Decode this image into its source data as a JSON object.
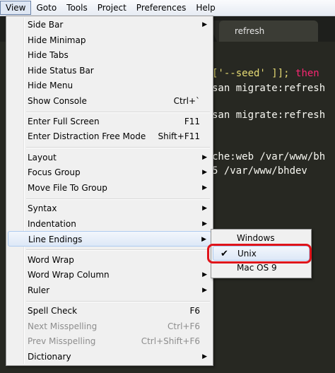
{
  "menubar": {
    "items": [
      "View",
      "Goto",
      "Tools",
      "Project",
      "Preferences",
      "Help"
    ],
    "active": "View"
  },
  "editor": {
    "tab_label": "refresh",
    "lines": {
      "l1a": "['--seed' ]]; ",
      "l1b": "then",
      "l2": "san migrate:refresh",
      "l3": "san migrate:refresh",
      "l4": "che:web /var/www/bh",
      "l5": "5 /var/www/bhdev"
    }
  },
  "view_menu": {
    "side_bar": "Side Bar",
    "hide_minimap": "Hide Minimap",
    "hide_tabs": "Hide Tabs",
    "hide_status_bar": "Hide Status Bar",
    "hide_menu": "Hide Menu",
    "show_console": "Show Console",
    "show_console_acc": "Ctrl+`",
    "enter_full_screen": "Enter Full Screen",
    "enter_full_screen_acc": "F11",
    "distraction_free": "Enter Distraction Free Mode",
    "distraction_free_acc": "Shift+F11",
    "layout": "Layout",
    "focus_group": "Focus Group",
    "move_file": "Move File To Group",
    "syntax": "Syntax",
    "indentation": "Indentation",
    "line_endings": "Line Endings",
    "word_wrap": "Word Wrap",
    "word_wrap_column": "Word Wrap Column",
    "ruler": "Ruler",
    "spell_check": "Spell Check",
    "spell_check_acc": "F6",
    "next_misspelling": "Next Misspelling",
    "next_misspelling_acc": "Ctrl+F6",
    "prev_misspelling": "Prev Misspelling",
    "prev_misspelling_acc": "Ctrl+Shift+F6",
    "dictionary": "Dictionary"
  },
  "line_endings_menu": {
    "windows": "Windows",
    "unix": "Unix",
    "mac": "Mac OS 9",
    "checked": "Unix"
  }
}
